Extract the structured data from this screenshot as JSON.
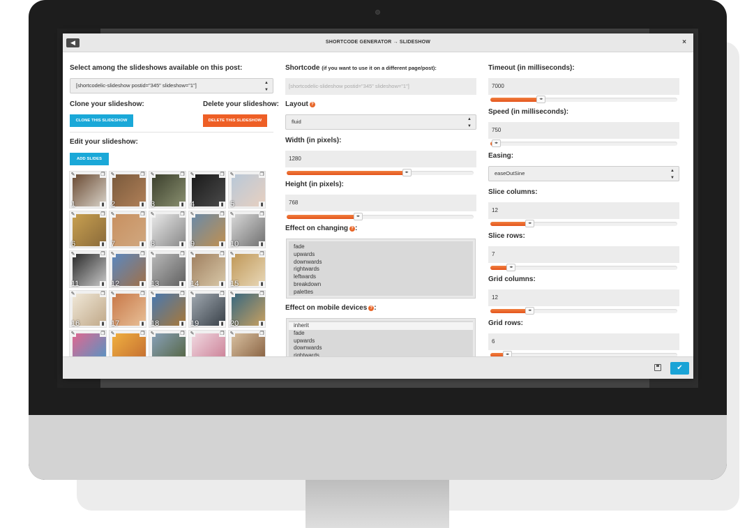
{
  "modal": {
    "title": "SHORTCODE GENERATOR → SLIDESHOW",
    "back_icon": "arrow-left-icon",
    "close_label": "×"
  },
  "col1": {
    "select_label": "Select among the slideshows available on this post:",
    "select_value": "[shortcodelic-slideshow postid=\"345\" slideshow=\"1\"]",
    "clone_label": "Clone your slideshow:",
    "clone_button": "CLONE THIS SLIDESHOW",
    "delete_label": "Delete your slideshow:",
    "delete_button": "DELETE THIS SLIDESHOW",
    "edit_label": "Edit your slideshow:",
    "add_button": "ADD SLIDES",
    "slides": [
      {
        "num": "1",
        "c1": "#6a4a32",
        "c2": "#d8d2c8"
      },
      {
        "num": "2",
        "c1": "#7a5a3c",
        "c2": "#b08058"
      },
      {
        "num": "3",
        "c1": "#3b3f2c",
        "c2": "#8a9070"
      },
      {
        "num": "4",
        "c1": "#1a1a1a",
        "c2": "#4b4b4b"
      },
      {
        "num": "5",
        "c1": "#b8c8d8",
        "c2": "#e8d0c0"
      },
      {
        "num": "6",
        "c1": "#c8a050",
        "c2": "#8a6a3a"
      },
      {
        "num": "7",
        "c1": "#c89060",
        "c2": "#d0a880"
      },
      {
        "num": "8",
        "c1": "#e8e8e8",
        "c2": "#888888"
      },
      {
        "num": "9",
        "c1": "#6a8aa8",
        "c2": "#c09050"
      },
      {
        "num": "10",
        "c1": "#d8d8d8",
        "c2": "#707070"
      },
      {
        "num": "11",
        "c1": "#2a2a2a",
        "c2": "#c8c8c8"
      },
      {
        "num": "12",
        "c1": "#5a88c0",
        "c2": "#a07048"
      },
      {
        "num": "13",
        "c1": "#b8b8b8",
        "c2": "#606060"
      },
      {
        "num": "14",
        "c1": "#a08060",
        "c2": "#d8c8a8"
      },
      {
        "num": "15",
        "c1": "#c09858",
        "c2": "#e8d8b8"
      },
      {
        "num": "16",
        "c1": "#f0e8d8",
        "c2": "#c0a888"
      },
      {
        "num": "17",
        "c1": "#c87848",
        "c2": "#e8c098"
      },
      {
        "num": "18",
        "c1": "#4878b0",
        "c2": "#a87838"
      },
      {
        "num": "19",
        "c1": "#a0a8b0",
        "c2": "#384048"
      },
      {
        "num": "20",
        "c1": "#386880",
        "c2": "#c8a060"
      },
      {
        "num": "",
        "c1": "#e06890",
        "c2": "#4898c8"
      },
      {
        "num": "",
        "c1": "#f0b040",
        "c2": "#c06830"
      },
      {
        "num": "",
        "c1": "#88a0b8",
        "c2": "#506038"
      },
      {
        "num": "",
        "c1": "#f0d8e0",
        "c2": "#c87890"
      },
      {
        "num": "",
        "c1": "#d8c0a0",
        "c2": "#805838"
      }
    ]
  },
  "col2": {
    "shortcode_label": "Shortcode",
    "shortcode_sub": "(if you want to use it on a different page/post):",
    "shortcode_value": "[shortcodelic-slideshow postid=\"345\" slideshow=\"1\"]",
    "layout_label": "Layout",
    "layout_value": "fluid",
    "width_label": "Width (in pixels):",
    "width_value": "1280",
    "width_fraction": 0.64,
    "height_label": "Height (in pixels):",
    "height_value": "768",
    "height_fraction": 0.38,
    "effect_label": "Effect on changing",
    "effect_options": [
      "fade",
      "upwards",
      "downwards",
      "rightwards",
      "leftwards",
      "breakdown",
      "palettes"
    ],
    "mobile_label": "Effect on mobile devices",
    "mobile_options": [
      "inherit",
      "fade",
      "upwards",
      "downwards",
      "rightwards"
    ]
  },
  "col3": {
    "timeout_label": "Timeout (in milliseconds):",
    "timeout_value": "7000",
    "timeout_fraction": 0.27,
    "speed_label": "Speed (in milliseconds):",
    "speed_value": "750",
    "speed_fraction": 0.03,
    "easing_label": "Easing:",
    "easing_value": "easeOutSine",
    "slice_cols_label": "Slice columns:",
    "slice_cols_value": "12",
    "slice_cols_fraction": 0.21,
    "slice_rows_label": "Slice rows:",
    "slice_rows_value": "7",
    "slice_rows_fraction": 0.11,
    "grid_cols_label": "Grid columns:",
    "grid_cols_value": "12",
    "grid_cols_fraction": 0.21,
    "grid_rows_label": "Grid rows:",
    "grid_rows_value": "6",
    "grid_rows_fraction": 0.09
  },
  "colors": {
    "accent_blue": "#1aa8d8",
    "accent_orange": "#ee5f26"
  }
}
